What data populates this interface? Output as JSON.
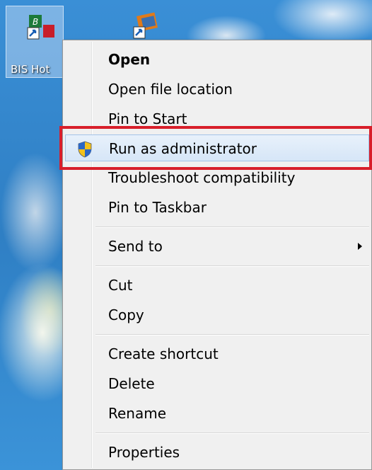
{
  "desktop": {
    "icons": [
      {
        "label": "BIS Hot"
      },
      {
        "label": ""
      }
    ]
  },
  "menu": {
    "items": [
      {
        "label": "Open"
      },
      {
        "label": "Open file location"
      },
      {
        "label": "Pin to Start"
      },
      {
        "label": "Run as administrator",
        "icon": "uac-shield-icon"
      },
      {
        "label": "Troubleshoot compatibility"
      },
      {
        "label": "Pin to Taskbar"
      },
      {
        "label": "Send to"
      },
      {
        "label": "Cut"
      },
      {
        "label": "Copy"
      },
      {
        "label": "Create shortcut"
      },
      {
        "label": "Delete"
      },
      {
        "label": "Rename"
      },
      {
        "label": "Properties"
      }
    ]
  },
  "colors": {
    "highlight_border": "#d81e2a",
    "hover_fill": "#d6e6f7",
    "menu_background": "#f0f0f0"
  }
}
